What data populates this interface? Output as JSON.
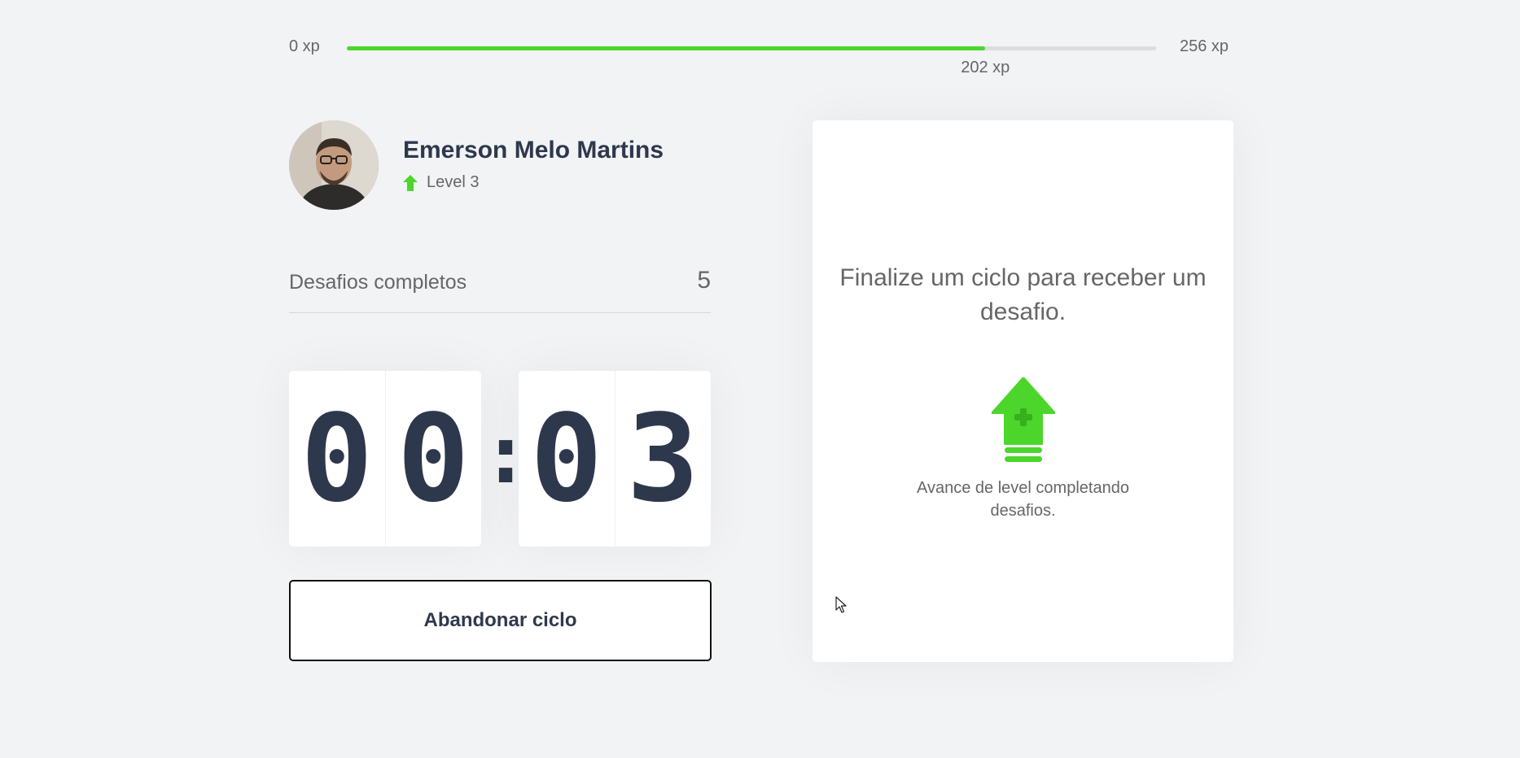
{
  "experience": {
    "min_label": "0 xp",
    "max_label": "256 xp",
    "current_label": "202 xp",
    "progress_fraction": 0.789,
    "fill_color": "#4cd62b"
  },
  "profile": {
    "name": "Emerson Melo Martins",
    "level_label": "Level 3",
    "avatar_icon": "avatar-photo",
    "level_icon": "level-up-arrow-icon"
  },
  "completed_challenges": {
    "label": "Desafios completos",
    "count": "5"
  },
  "countdown": {
    "minute_left": "0",
    "minute_right": "0",
    "separator": ":",
    "second_left": "0",
    "second_right": "3"
  },
  "abandon_button": {
    "label": "Abandonar ciclo"
  },
  "challenge_box": {
    "title": "Finalize um ciclo para receber um desafio.",
    "icon": "level-up-icon",
    "hint": "Avance de level completando desafios."
  },
  "colors": {
    "background": "#f2f3f5",
    "text": "#666666",
    "title": "#2e384d",
    "green": "#4cd62b"
  }
}
